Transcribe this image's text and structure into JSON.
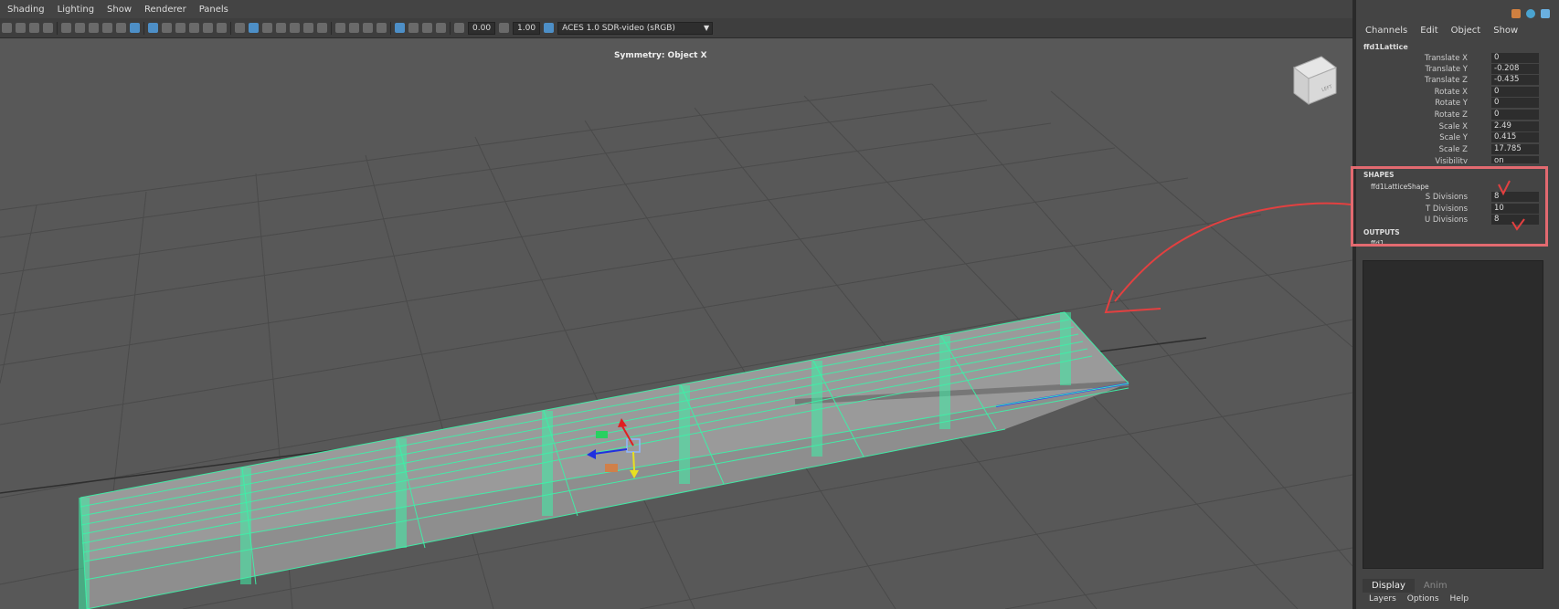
{
  "menubar": {
    "items": [
      "Shading",
      "Lighting",
      "Show",
      "Renderer",
      "Panels"
    ]
  },
  "toolbar": {
    "exposure": "0.00",
    "gamma": "1.00",
    "colorspace": "ACES 1.0 SDR-video (sRGB)"
  },
  "viewport": {
    "symmetry": "Symmetry: Object X",
    "viewcube_label": "LEFT"
  },
  "channelbox": {
    "menu": [
      "Channels",
      "Edit",
      "Object",
      "Show"
    ],
    "node": "ffd1Lattice",
    "attributes": [
      {
        "label": "Translate X",
        "value": "0"
      },
      {
        "label": "Translate Y",
        "value": "-0.208"
      },
      {
        "label": "Translate Z",
        "value": "-0.435"
      },
      {
        "label": "Rotate X",
        "value": "0"
      },
      {
        "label": "Rotate Y",
        "value": "0"
      },
      {
        "label": "Rotate Z",
        "value": "0"
      },
      {
        "label": "Scale X",
        "value": "2.49"
      },
      {
        "label": "Scale Y",
        "value": "0.415"
      },
      {
        "label": "Scale Z",
        "value": "17.785"
      },
      {
        "label": "Visibility",
        "value": "on"
      }
    ],
    "shapes_header": "SHAPES",
    "shape_name": "ffd1LatticeShape",
    "shape_attributes": [
      {
        "label": "S Divisions",
        "value": "8"
      },
      {
        "label": "T Divisions",
        "value": "10"
      },
      {
        "label": "U Divisions",
        "value": "8"
      }
    ],
    "outputs_header": "OUTPUTS",
    "outputs_partial": "ffd1"
  },
  "layers": {
    "tabs": [
      "Display",
      "Anim"
    ],
    "menu": [
      "Layers",
      "Options",
      "Help"
    ]
  },
  "colors": {
    "lattice": "#3ef0a8",
    "annotation": "#e34040",
    "highlight": "#e36a70",
    "viewport_bg": "#585858"
  }
}
